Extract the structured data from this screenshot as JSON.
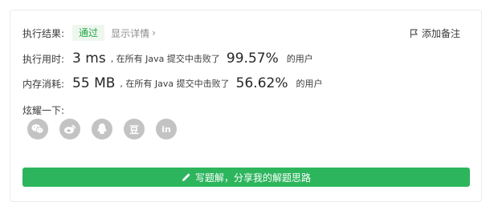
{
  "result": {
    "label": "执行结果:",
    "status": "通过",
    "detail_link": "显示详情",
    "add_note": "添加备注"
  },
  "runtime": {
    "label": "执行用时:",
    "value": "3 ms",
    "mid_text": ", 在所有 Java 提交中击败了",
    "percent": "99.57%",
    "tail_text": "的用户"
  },
  "memory": {
    "label": "内存消耗:",
    "value": "55 MB",
    "mid_text": ", 在所有 Java 提交中击败了",
    "percent": "56.62%",
    "tail_text": "的用户"
  },
  "share": {
    "label": "炫耀一下:",
    "icons": [
      "wechat-icon",
      "weibo-icon",
      "qq-icon",
      "douban-icon",
      "linkedin-icon"
    ],
    "douban_glyph": "豆",
    "linkedin_glyph": "in"
  },
  "solution_button": {
    "label": "写题解，分享我的解题思路"
  },
  "colors": {
    "accent_green": "#2db55d",
    "status_green": "#24a844",
    "icon_gray": "#c3c3c3"
  }
}
